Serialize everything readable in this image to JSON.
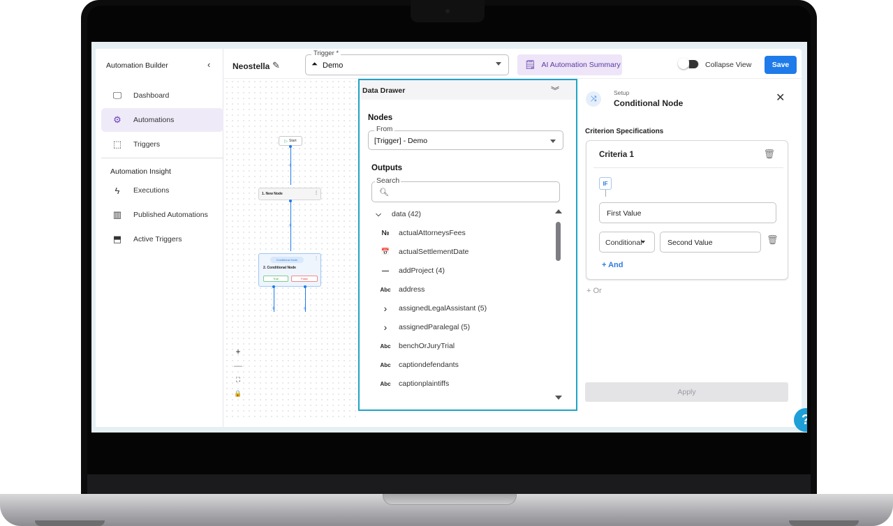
{
  "sidebar": {
    "title": "Automation Builder",
    "collapse_icon": "chevron-left-icon",
    "items": [
      {
        "label": "Dashboard",
        "icon": "monitor-icon"
      },
      {
        "label": "Automations",
        "icon": "automation-icon",
        "active": true
      },
      {
        "label": "Triggers",
        "icon": "trigger-icon"
      }
    ],
    "section": "Automation Insight",
    "insight_items": [
      {
        "label": "Executions",
        "icon": "bolt-icon"
      },
      {
        "label": "Published Automations",
        "icon": "library-icon"
      },
      {
        "label": "Active Triggers",
        "icon": "active-trigger-icon"
      }
    ]
  },
  "header": {
    "automation_name": "Neostella",
    "trigger_label": "Trigger *",
    "trigger_value": "Demo",
    "ai_summary_label": "AI Automation Summary",
    "collapse_view_label": "Collapse View",
    "save_label": "Save"
  },
  "canvas": {
    "start_label": "Start",
    "node1_label": "1. New Node",
    "cond_chip": "Conditional Node",
    "cond_label": "2. Conditional Node",
    "true_label": "True",
    "false_label": "False",
    "zoom_in": "+",
    "zoom_out": "—",
    "fit": "⛶",
    "lock": "🔒"
  },
  "drawer": {
    "title": "Data Drawer",
    "nodes_title": "Nodes",
    "from_label": "From",
    "from_value": "[Trigger] - Demo",
    "outputs_title": "Outputs",
    "search_label": "Search",
    "items": [
      {
        "icon": "⌵",
        "label": "data (42)"
      },
      {
        "icon": "№",
        "label": "actualAttorneysFees"
      },
      {
        "icon": "📅",
        "label": "actualSettlementDate"
      },
      {
        "icon": "—",
        "label": "addProject (4)"
      },
      {
        "icon": "Abc",
        "label": "address"
      },
      {
        "icon": "›",
        "label": "assignedLegalAssistant (5)"
      },
      {
        "icon": "›",
        "label": "assignedParalegal (5)"
      },
      {
        "icon": "Abc",
        "label": "benchOrJuryTrial"
      },
      {
        "icon": "Abc",
        "label": "captiondefendants"
      },
      {
        "icon": "Abc",
        "label": "captionplaintiffs"
      }
    ]
  },
  "setup": {
    "small_label": "Setup",
    "node_name": "Conditional Node",
    "criterion_title": "Criterion Specifications",
    "criteria_name": "Criteria 1",
    "if_label": "IF",
    "first_value": "First Value",
    "conditional_label": "Conditional",
    "second_value": "Second Value",
    "and_label": "+ And",
    "or_label": "+ Or",
    "apply_label": "Apply"
  },
  "help_label": "?"
}
